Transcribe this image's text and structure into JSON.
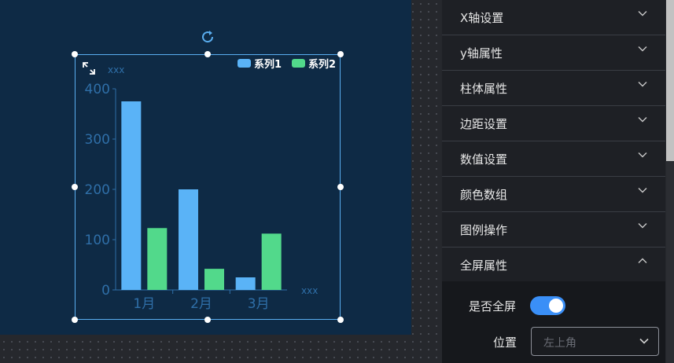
{
  "chart_data": {
    "type": "bar",
    "categories": [
      "1月",
      "2月",
      "3月"
    ],
    "series": [
      {
        "name": "系列1",
        "values": [
          375,
          200,
          25
        ],
        "color": "#5ab3f7"
      },
      {
        "name": "系列2",
        "values": [
          123,
          42,
          112
        ],
        "color": "#52d98b"
      }
    ],
    "ylabel": "xxx",
    "xlabel": "xxx",
    "ylim": [
      0,
      400
    ],
    "yticks": [
      0,
      100,
      200,
      300,
      400
    ],
    "grid": false,
    "legend": "top-right",
    "axis_color": "#2f6fa8"
  },
  "panel": {
    "sections": [
      {
        "label": "X轴设置",
        "expanded": false
      },
      {
        "label": "y轴属性",
        "expanded": false
      },
      {
        "label": "柱体属性",
        "expanded": false
      },
      {
        "label": "边距设置",
        "expanded": false
      },
      {
        "label": "数值设置",
        "expanded": false
      },
      {
        "label": "颜色数组",
        "expanded": false
      },
      {
        "label": "图例操作",
        "expanded": false
      },
      {
        "label": "全屏属性",
        "expanded": true
      }
    ],
    "fullscreen": {
      "toggle_label": "是否全屏",
      "toggle_on": true,
      "position_label": "位置",
      "position_placeholder": "左上角"
    }
  },
  "colors": {
    "accent": "#3a8ff7",
    "canvas_bg": "#0e2a45",
    "selection_border": "#5aaef0"
  }
}
